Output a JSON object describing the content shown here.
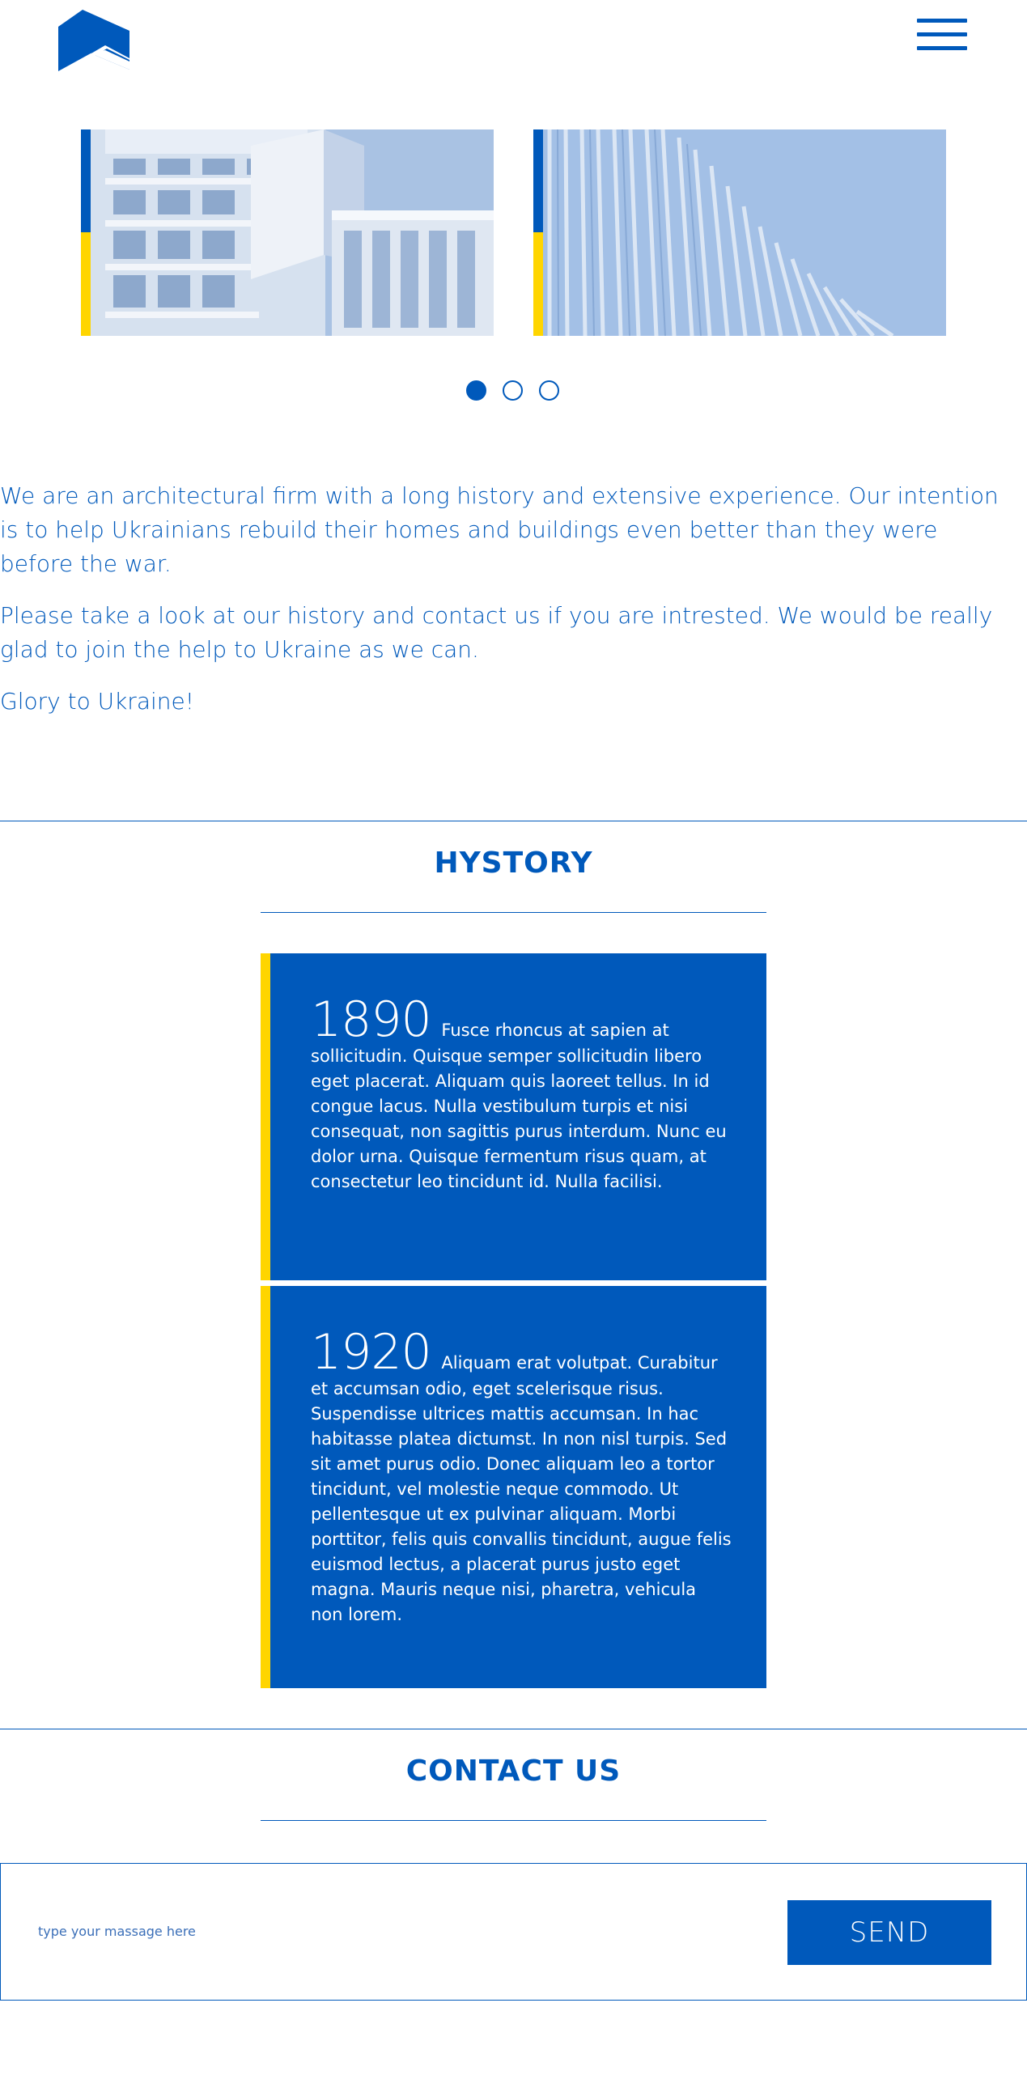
{
  "header": {
    "logo_icon": "house-roof-logo-icon",
    "menu_icon": "hamburger-menu-icon"
  },
  "slider": {
    "slides": [
      {
        "image": "white-apartment-building-image"
      },
      {
        "image": "curved-facade-building-image"
      }
    ],
    "active_dot": 0,
    "dot_count": 3
  },
  "intro": {
    "paragraphs": [
      "We are an architectural firm with a long history and extensive experience. Our intention is to help Ukrainians rebuild their homes and buildings even better than they were before the war.",
      "Please take a look at our history and contact us if you are intrested. We would be really glad to join the help to Ukraine as we can.",
      "Glory to Ukraine!"
    ]
  },
  "history": {
    "title": "HYSTORY",
    "entries": [
      {
        "year": "1890",
        "text": "Fusce rhoncus at sapien at sollicitudin. Quisque semper sollicitudin libero eget placerat. Aliquam quis laoreet tellus. In id congue lacus. Nulla vestibulum turpis et nisi consequat, non sagittis purus interdum. Nunc eu dolor urna. Quisque fermentum risus quam, at consectetur leo tincidunt id. Nulla facilisi."
      },
      {
        "year": "1920",
        "text": "Aliquam erat volutpat. Curabitur et accumsan odio, eget scelerisque risus. Suspendisse ultrices mattis accumsan. In hac habitasse platea dictumst. In non nisl turpis. Sed sit amet purus odio. Donec aliquam leo a tortor tincidunt, vel molestie neque commodo. Ut pellentesque ut ex pulvinar aliquam. Morbi porttitor, felis quis convallis tincidunt, augue felis euismod lectus, a placerat purus justo eget magna. Mauris neque nisi, pharetra, vehicula non lorem."
      }
    ]
  },
  "contact": {
    "title": "CONTACT US",
    "input_value": "",
    "input_placeholder": "type your massage here",
    "send_label": "SEND"
  },
  "colors": {
    "brand_blue": "#0059bb",
    "accent_yellow": "#ffd500",
    "background": "#ffffff"
  }
}
